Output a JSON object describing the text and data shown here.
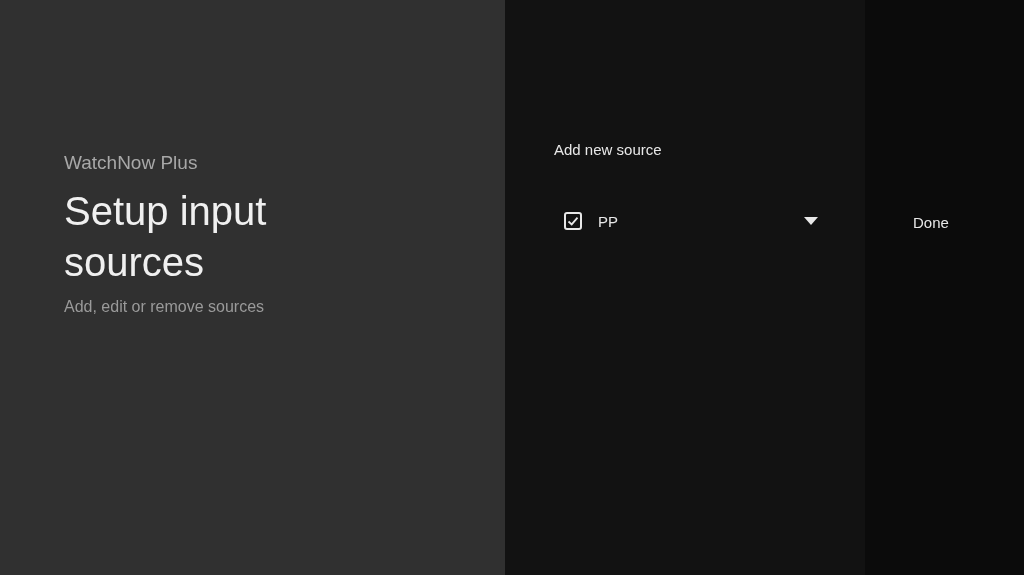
{
  "guidance": {
    "app_name": "WatchNow Plus",
    "title": "Setup input sources",
    "description": "Add, edit or remove sources"
  },
  "sources": {
    "header": "Add new source",
    "items": [
      {
        "label": "PP",
        "checked": true
      }
    ]
  },
  "actions": [
    {
      "label": "Done"
    }
  ]
}
